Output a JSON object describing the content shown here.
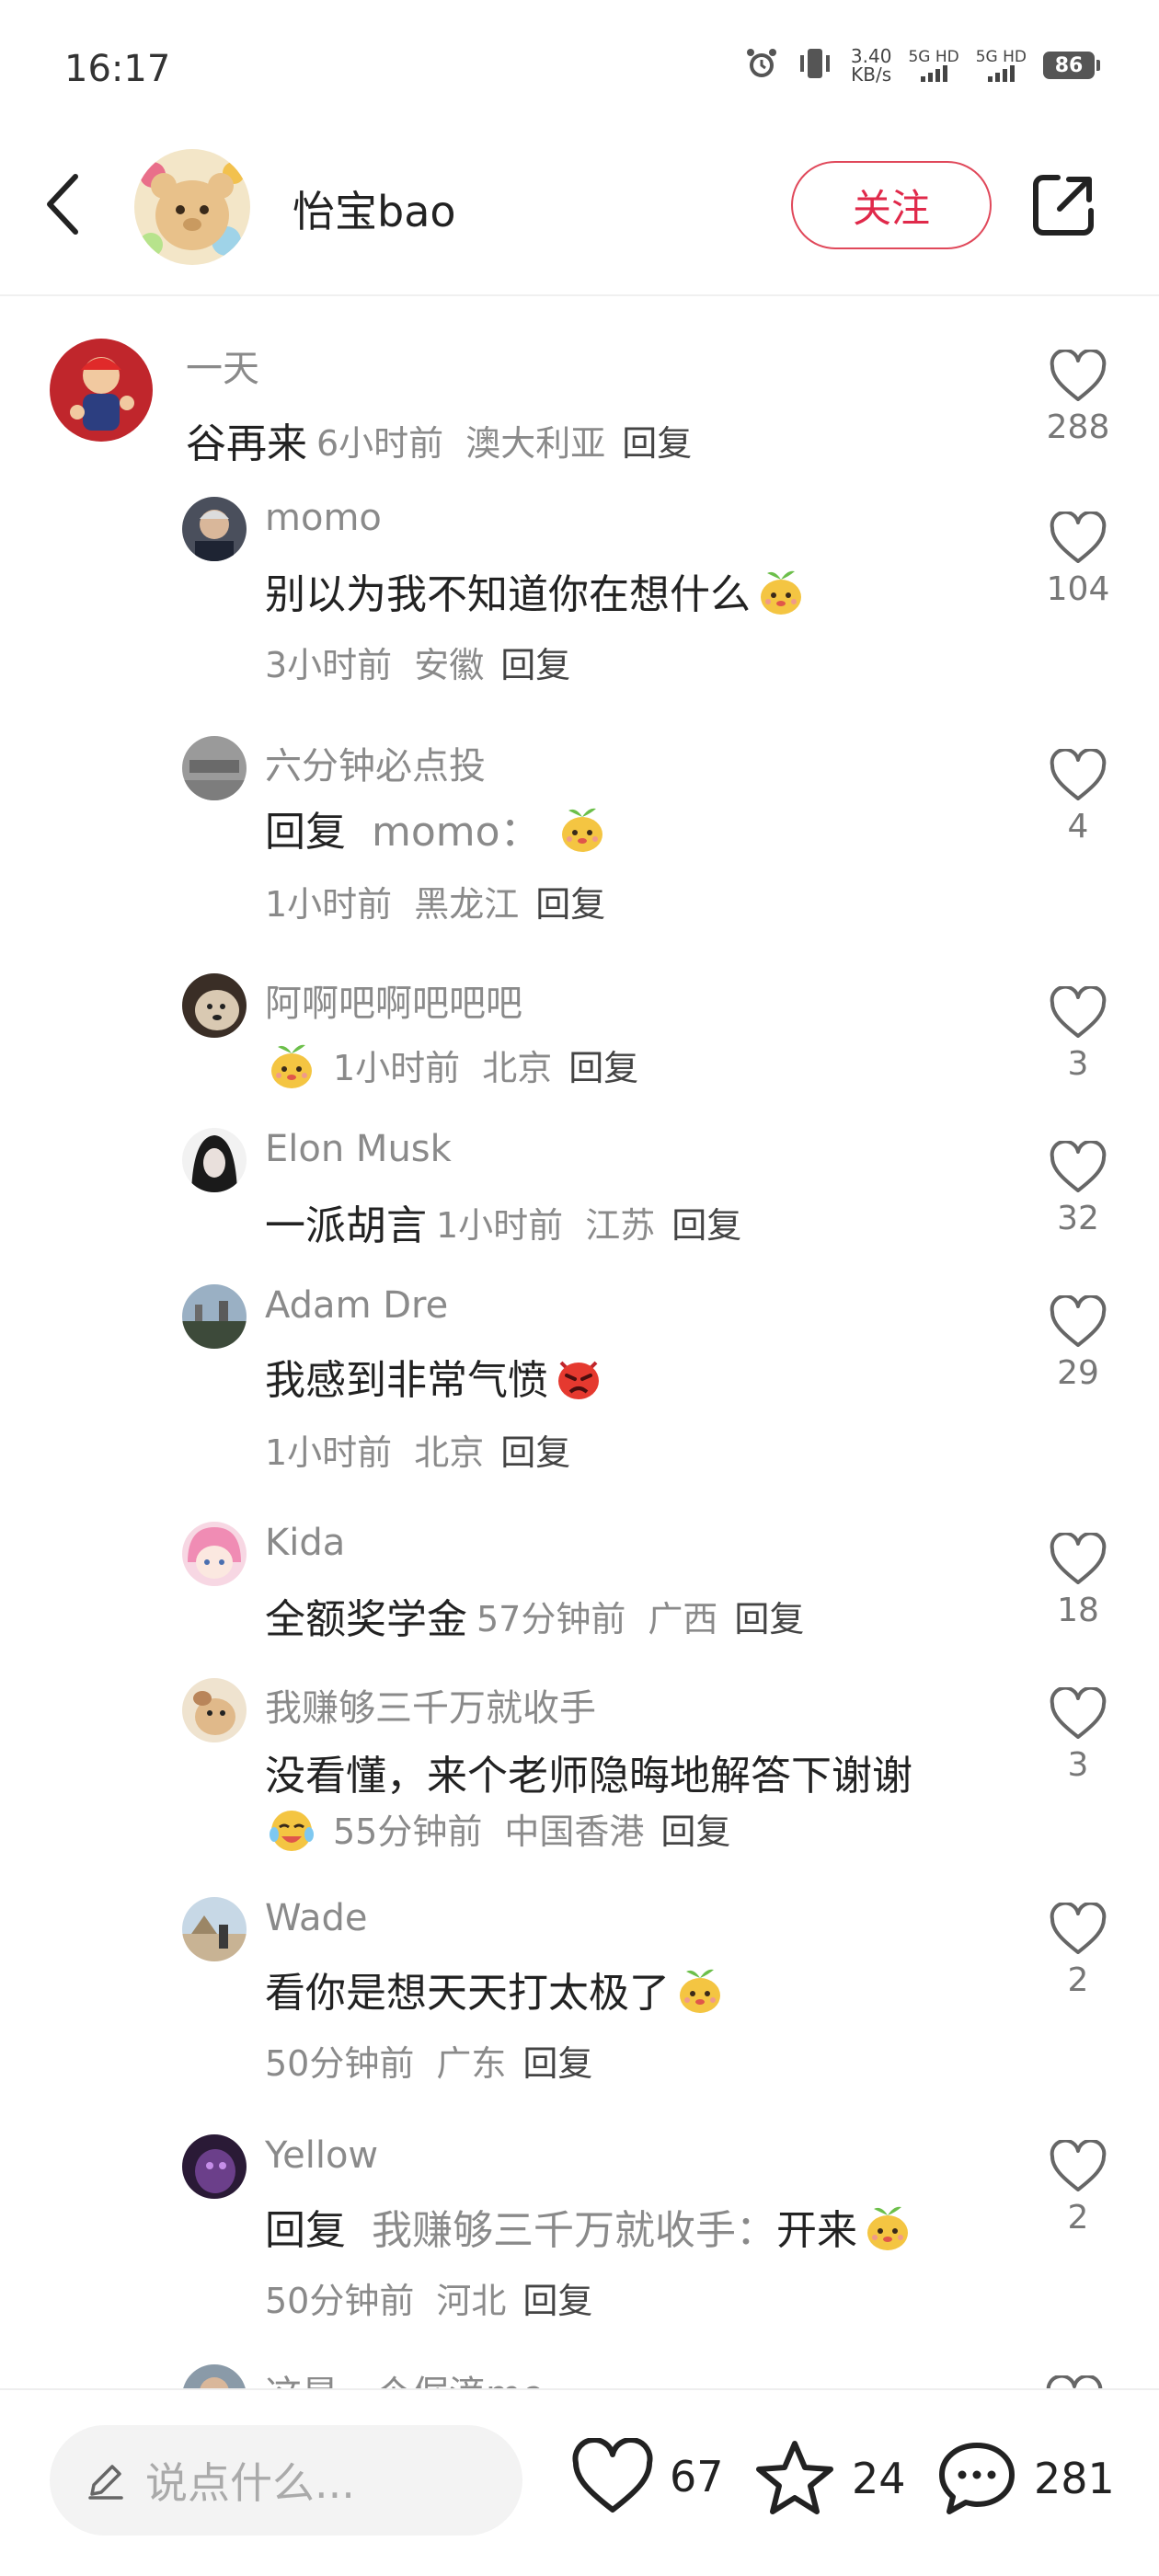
{
  "status_bar": {
    "time": "16:17",
    "net_speed_value": "3.40",
    "net_speed_unit": "KB/s",
    "sim1_label": "5G HD",
    "sim2_label": "5G HD",
    "battery": "86"
  },
  "header": {
    "username": "怡宝bao",
    "follow_label": "关注"
  },
  "comments": [
    {
      "name": "一天",
      "text": "谷再来",
      "time": "6小时前",
      "location": "澳大利亚",
      "reply": "回复",
      "likes": "288"
    },
    {
      "name": "momo",
      "text": "别以为我不知道你在想什么",
      "time": "3小时前",
      "location": "安徽",
      "reply": "回复",
      "likes": "104"
    },
    {
      "name": "六分钟必点投",
      "text": "回复",
      "reply_to": "momo：",
      "time": "1小时前",
      "location": "黑龙江",
      "reply": "回复",
      "likes": "4"
    },
    {
      "name": "阿啊吧啊吧吧吧",
      "time": "1小时前",
      "location": "北京",
      "reply": "回复",
      "likes": "3"
    },
    {
      "name": "Elon Musk",
      "text": "一派胡言",
      "time": "1小时前",
      "location": "江苏",
      "reply": "回复",
      "likes": "32"
    },
    {
      "name": "Adam Dre",
      "text": "我感到非常气愤",
      "time": "1小时前",
      "location": "北京",
      "reply": "回复",
      "likes": "29"
    },
    {
      "name": "Kida",
      "text": "全额奖学金",
      "time": "57分钟前",
      "location": "广西",
      "reply": "回复",
      "likes": "18"
    },
    {
      "name": "我赚够三千万就收手",
      "text": "没看懂，来个老师隐晦地解答下谢谢",
      "time": "55分钟前",
      "location": "中国香港",
      "reply": "回复",
      "likes": "3"
    },
    {
      "name": "Wade",
      "text": "看你是想天天打太极了",
      "time": "50分钟前",
      "location": "广东",
      "reply": "回复",
      "likes": "2"
    },
    {
      "name": "Yellow",
      "text": "回复",
      "reply_to": "我赚够三千万就收手：",
      "text2": "开来",
      "time": "50分钟前",
      "location": "河北",
      "reply": "回复",
      "likes": "2"
    }
  ],
  "partial_comment": {
    "name": "这是一个倔滴me"
  },
  "bottom_bar": {
    "input_placeholder": "说点什么...",
    "likes": "67",
    "favorites": "24",
    "comments": "281"
  },
  "icons": {
    "back": "chevron-left-icon",
    "share": "share-icon",
    "like": "heart-icon",
    "star": "star-icon",
    "comment": "comment-icon",
    "pen": "pen-icon",
    "alarm": "alarm-icon",
    "vibrate": "vibrate-icon"
  },
  "colors": {
    "accent": "#e0294a",
    "muted_text": "#8a8a8a",
    "text": "#222222"
  }
}
